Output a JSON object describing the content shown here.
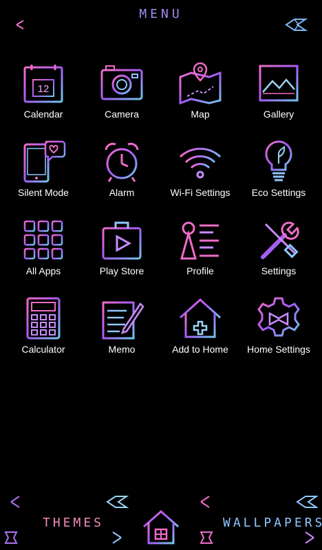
{
  "header": {
    "title": "MENU"
  },
  "apps": [
    {
      "label": "Calendar",
      "icon": "calendar-icon",
      "date": "12"
    },
    {
      "label": "Camera",
      "icon": "camera-icon"
    },
    {
      "label": "Map",
      "icon": "map-icon"
    },
    {
      "label": "Gallery",
      "icon": "gallery-icon"
    },
    {
      "label": "Silent Mode",
      "icon": "silent-mode-icon"
    },
    {
      "label": "Alarm",
      "icon": "alarm-clock-icon"
    },
    {
      "label": "Wi-Fi Settings",
      "icon": "wifi-icon"
    },
    {
      "label": "Eco Settings",
      "icon": "eco-bulb-icon"
    },
    {
      "label": "All Apps",
      "icon": "all-apps-grid-icon"
    },
    {
      "label": "Play Store",
      "icon": "play-store-icon"
    },
    {
      "label": "Profile",
      "icon": "profile-icon"
    },
    {
      "label": "Settings",
      "icon": "settings-tools-icon"
    },
    {
      "label": "Calculator",
      "icon": "calculator-icon"
    },
    {
      "label": "Memo",
      "icon": "memo-icon"
    },
    {
      "label": "Add to Home",
      "icon": "add-to-home-icon"
    },
    {
      "label": "Home Settings",
      "icon": "home-settings-gear-icon"
    }
  ],
  "bottom": {
    "themes_label": "THEMES",
    "wallpapers_label": "WALLPAPERS",
    "home_icon": "home-icon"
  },
  "colors": {
    "background": "#000000",
    "gradient_pink": "#f06cc8",
    "gradient_purple": "#9a5cf5",
    "gradient_blue": "#6fc8f0"
  }
}
